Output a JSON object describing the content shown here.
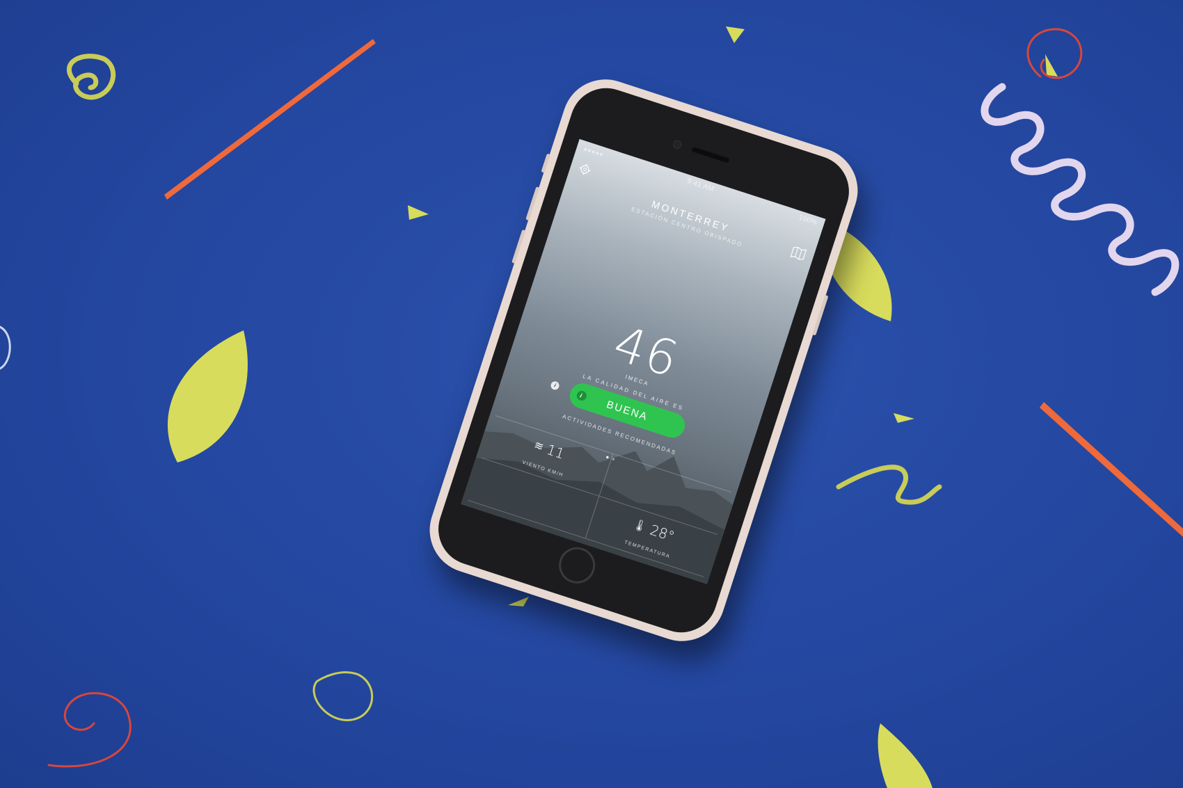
{
  "status_bar": {
    "time": "9:41 AM",
    "battery": "100%"
  },
  "app": {
    "city": "MONTERREY",
    "station": "ESTACIÓN CENTRO OBISPADO",
    "aqi_value": "46",
    "aqi_index_label": "IMECA",
    "quality_prefix": "LA CALIDAD DEL AIRE ES",
    "quality_label": "BUENA",
    "quality_color": "#2fc450",
    "activities_label": "ACTIVIDADES RECOMENDADAS"
  },
  "tiles": [
    {
      "icon": "wind-icon",
      "value": "11",
      "label": "VIENTO KM/H"
    },
    {
      "icon": "thermometer-icon",
      "value": "28°",
      "label": "TEMPERATURA"
    }
  ],
  "background": {
    "color": "#25479f",
    "decorations": [
      "yellow paper leaves",
      "orange paper strips",
      "curled paper ribbons",
      "yellow confetti triangles"
    ]
  }
}
